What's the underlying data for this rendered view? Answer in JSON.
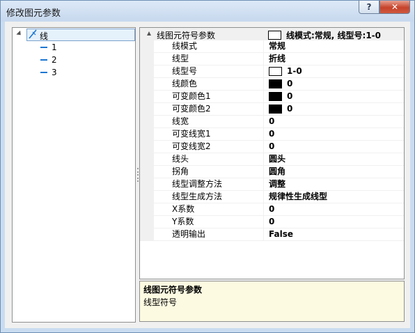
{
  "window": {
    "title": "修改图元参数",
    "help_label": "?",
    "close_label": "✕"
  },
  "tree": {
    "root": {
      "label": "线",
      "icon": "line-tool-icon"
    },
    "children": [
      {
        "label": "1",
        "icon": "line-dash-icon"
      },
      {
        "label": "2",
        "icon": "line-dash-icon"
      },
      {
        "label": "3",
        "icon": "line-dash-icon"
      }
    ]
  },
  "property_grid": {
    "category": {
      "name": "线图元符号参数",
      "value": "线模式:常规, 线型号:1-0",
      "swatch_color": "#ffffff"
    },
    "properties": [
      {
        "name": "线模式",
        "value": "常规"
      },
      {
        "name": "线型",
        "value": "折线"
      },
      {
        "name": "线型号",
        "value": "1-0",
        "swatch_color": "#ffffff"
      },
      {
        "name": "线颜色",
        "value": "0",
        "swatch_color": "#000000"
      },
      {
        "name": "可变颜色1",
        "value": "0",
        "swatch_color": "#000000"
      },
      {
        "name": "可变颜色2",
        "value": "0",
        "swatch_color": "#000000"
      },
      {
        "name": "线宽",
        "value": "0"
      },
      {
        "name": "可变线宽1",
        "value": "0"
      },
      {
        "name": "可变线宽2",
        "value": "0"
      },
      {
        "name": "线头",
        "value": "圆头"
      },
      {
        "name": "拐角",
        "value": "圆角"
      },
      {
        "name": "线型调整方法",
        "value": "调整"
      },
      {
        "name": "线型生成方法",
        "value": "规律性生成线型"
      },
      {
        "name": "X系数",
        "value": "0"
      },
      {
        "name": "Y系数",
        "value": "0"
      },
      {
        "name": "透明输出",
        "value": "False"
      }
    ]
  },
  "description": {
    "title": "线图元符号参数",
    "text": "线型符号"
  },
  "colors": {
    "selection_bg": "#e5f1fb",
    "description_bg": "#fcfae1",
    "tree_icon_blue": "#1976d2"
  }
}
